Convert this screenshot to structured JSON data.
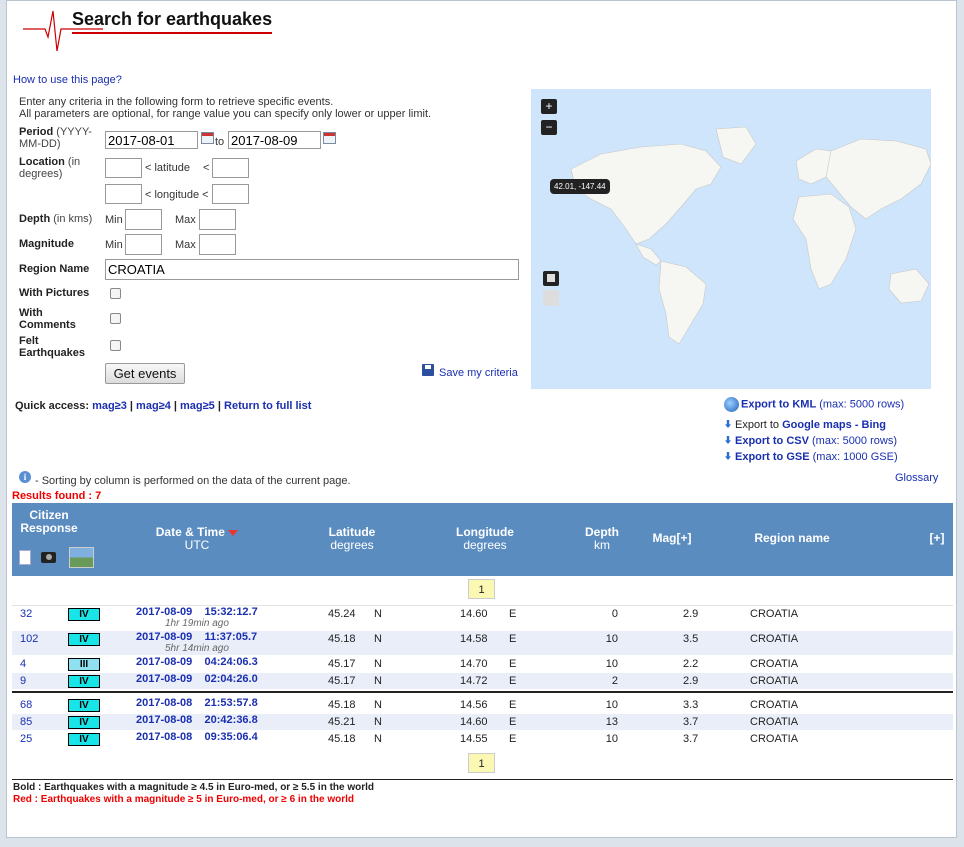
{
  "header": {
    "title": "Search for earthquakes"
  },
  "howto_link": "How to use this page?",
  "intro": {
    "line1": "Enter any criteria in the following form to retrieve specific events.",
    "line2": "All parameters are optional, for range value you can specify only lower or upper limit."
  },
  "form": {
    "period_label": "Period",
    "period_unit": "(YYYY-MM-DD)",
    "period_from": "2017-08-01",
    "period_to_word": "to",
    "period_to": "2017-08-09",
    "location_label": "Location",
    "location_unit": "(in degrees)",
    "latitude_text": "< latitude",
    "latitude_lt": "<",
    "longitude_text": "< longitude <",
    "depth_label": "Depth",
    "depth_unit": "(in kms)",
    "min_label": "Min",
    "max_label": "Max",
    "magnitude_label": "Magnitude",
    "region_label": "Region Name",
    "region_value": "CROATIA",
    "pictures_label": "With Pictures",
    "comments_label": "With Comments",
    "felt_label": "Felt Earthquakes",
    "submit_label": "Get events",
    "save_label": "Save my criteria"
  },
  "map": {
    "zoom_in": "+",
    "zoom_out": "−",
    "tooltip": "42.01, -147.44"
  },
  "quick": {
    "label": "Quick access:",
    "links": [
      "mag≥3",
      "mag≥4",
      "mag≥5",
      "Return to full list"
    ],
    "sep": "|"
  },
  "export": {
    "kml_label": "Export to KML",
    "kml_note": "(max: 5000 rows)",
    "maps_prefix": "Export to",
    "maps_label": "Google maps - Bing",
    "csv_label": "Export to CSV",
    "csv_note": "(max: 5000 rows)",
    "gse_label": "Export to GSE",
    "gse_note": "(max: 1000 GSE)"
  },
  "sorting_note": "- Sorting by column is performed on the data of the current page.",
  "glossary_link": "Glossary",
  "results_found": "Results found : 7",
  "table": {
    "headers": {
      "citizen": "Citizen Response",
      "datetime": "Date & Time",
      "datetime_sub": "UTC",
      "lat": "Latitude",
      "lat_sub": "degrees",
      "lon": "Longitude",
      "lon_sub": "degrees",
      "depth": "Depth",
      "depth_sub": "km",
      "mag": "Mag[+]",
      "region": "Region name",
      "more": "[+]"
    },
    "page": "1",
    "rows": [
      {
        "resp": "32",
        "int": "IV",
        "date": "2017-08-09",
        "time": "15:32:12.7",
        "ago": "1hr 19min ago",
        "lat": "45.24",
        "ns": "N",
        "lon": "14.60",
        "ew": "E",
        "depth": "0",
        "mag": "2.9",
        "region": "CROATIA"
      },
      {
        "resp": "102",
        "int": "IV",
        "date": "2017-08-09",
        "time": "11:37:05.7",
        "ago": "5hr 14min ago",
        "lat": "45.18",
        "ns": "N",
        "lon": "14.58",
        "ew": "E",
        "depth": "10",
        "mag": "3.5",
        "region": "CROATIA"
      },
      {
        "resp": "4",
        "int": "III",
        "date": "2017-08-09",
        "time": "04:24:06.3",
        "ago": "",
        "lat": "45.17",
        "ns": "N",
        "lon": "14.70",
        "ew": "E",
        "depth": "10",
        "mag": "2.2",
        "region": "CROATIA"
      },
      {
        "resp": "9",
        "int": "IV",
        "date": "2017-08-09",
        "time": "02:04:26.0",
        "ago": "",
        "lat": "45.17",
        "ns": "N",
        "lon": "14.72",
        "ew": "E",
        "depth": "2",
        "mag": "2.9",
        "region": "CROATIA"
      },
      {
        "resp": "68",
        "int": "IV",
        "date": "2017-08-08",
        "time": "21:53:57.8",
        "ago": "",
        "lat": "45.18",
        "ns": "N",
        "lon": "14.56",
        "ew": "E",
        "depth": "10",
        "mag": "3.3",
        "region": "CROATIA"
      },
      {
        "resp": "85",
        "int": "IV",
        "date": "2017-08-08",
        "time": "20:42:36.8",
        "ago": "",
        "lat": "45.21",
        "ns": "N",
        "lon": "14.60",
        "ew": "E",
        "depth": "13",
        "mag": "3.7",
        "region": "CROATIA"
      },
      {
        "resp": "25",
        "int": "IV",
        "date": "2017-08-08",
        "time": "09:35:06.4",
        "ago": "",
        "lat": "45.18",
        "ns": "N",
        "lon": "14.55",
        "ew": "E",
        "depth": "10",
        "mag": "3.7",
        "region": "CROATIA"
      }
    ]
  },
  "legend": {
    "bold": "Bold : Earthquakes with a magnitude ≥ 4.5 in Euro-med, or ≥ 5.5 in the world",
    "red": "Red : Earthquakes with a magnitude ≥ 5 in Euro-med, or ≥ 6 in the world"
  },
  "colors": {
    "header_blue": "#5b8cc0",
    "intensity_iv": "#19e5e8",
    "intensity_iii": "#8fe0f0",
    "link": "#1a2fb0",
    "accent_red": "#cc0000"
  }
}
